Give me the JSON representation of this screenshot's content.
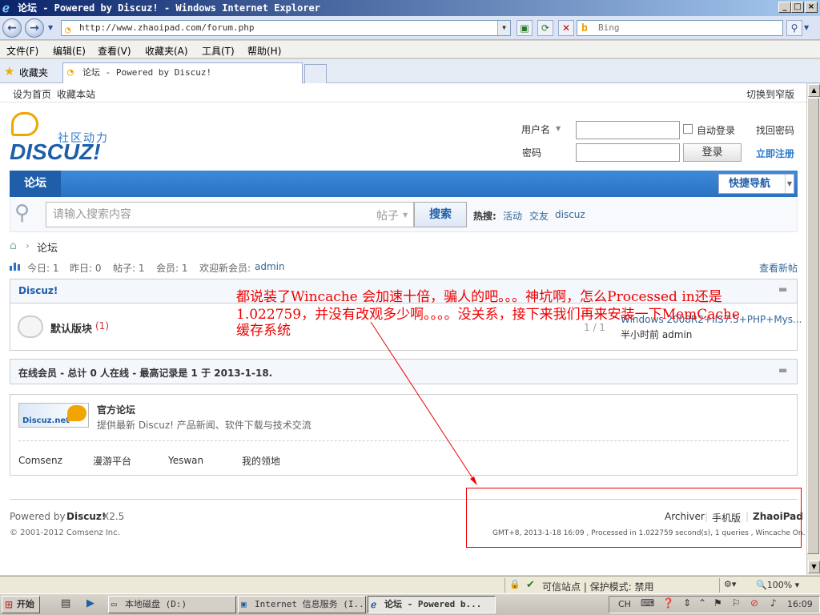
{
  "window": {
    "title": "论坛 - Powered by Discuz! - Windows Internet Explorer",
    "min": "_",
    "max": "□",
    "close": "×"
  },
  "address": {
    "url": "http://www.zhaoipad.com/forum.php",
    "search_placeholder": "Bing"
  },
  "menu": [
    "文件(F)",
    "编辑(E)",
    "查看(V)",
    "收藏夹(A)",
    "工具(T)",
    "帮助(H)"
  ],
  "favorites": {
    "label": "收藏夹",
    "tab_title": "论坛 - Powered by Discuz!"
  },
  "topbar": {
    "set_home": "设为首页",
    "bookmark": "收藏本站",
    "narrow": "切换到窄版"
  },
  "logo": {
    "slogan": "社区动力",
    "name": "DISCUZ!"
  },
  "login": {
    "username_label": "用户名",
    "password_label": "密码",
    "auto_login": "自动登录",
    "login_button": "登录",
    "forgot": "找回密码",
    "register": "立即注册"
  },
  "nav": {
    "forum_tab": "论坛",
    "quick_nav": "快捷导航"
  },
  "search": {
    "placeholder": "请输入搜索内容",
    "type": "帖子",
    "button": "搜索",
    "hot_label": "热搜:",
    "hot_items": [
      "活动",
      "交友",
      "discuz"
    ]
  },
  "breadcrumb": {
    "current": "论坛"
  },
  "stats": {
    "today": "今日: 1",
    "yesterday": "昨日: 0",
    "posts": "帖子: 1",
    "members": "会员: 1",
    "welcome": "欢迎新会员:",
    "new_member": "admin",
    "new_posts": "查看新帖"
  },
  "category": {
    "title": "Discuz!",
    "forum_name": "默认版块",
    "forum_count": "(1)",
    "counts": "1 / 1",
    "last_post_title": "Windows 2008R2+IIS7.5+PHP+Mys...",
    "last_post_meta": "半小时前 admin"
  },
  "online": {
    "text": "在线会员 - 总计 0 人在线 - 最高记录是 1 于 2013-1-18."
  },
  "links": {
    "official_logo": "Discuz.net",
    "official_title": "官方论坛",
    "official_desc": "提供最新 Discuz! 产品新闻、软件下载与技术交流",
    "items": [
      "Comsenz",
      "漫游平台",
      "Yeswan",
      "我的领地"
    ]
  },
  "footer": {
    "powered_by": "Powered by",
    "product": "Discuz!",
    "version": "X2.5",
    "copyright": "© 2001-2012 Comsenz Inc.",
    "archiver": "Archiver",
    "mobile": "手机版",
    "site": "ZhaoiPad",
    "perf": "GMT+8, 2013-1-18 16:09 , Processed in 1.022759 second(s), 1 queries , Wincache On."
  },
  "annotation": {
    "line1": "都说装了Wincache 会加速十倍，骗人的吧。。。神坑啊，怎么Processed in还是",
    "line2": "1.022759，并没有改观多少啊。。。。没关系，接下来我们再来安装一下MemCache",
    "line3": "缓存系统"
  },
  "statusbar": {
    "trusted": "可信站点 | 保护模式: 禁用",
    "zoom": "100%"
  },
  "taskbar": {
    "start": "开始",
    "tasks": [
      "本地磁盘 (D:)",
      "Internet 信息服务 (I...",
      "论坛 - Powered b..."
    ],
    "lang": "CH",
    "clock": "16:09"
  },
  "colors": {
    "nav_blue": "#2b7acd",
    "annotation_red": "#e00000",
    "link_blue": "#336699"
  }
}
